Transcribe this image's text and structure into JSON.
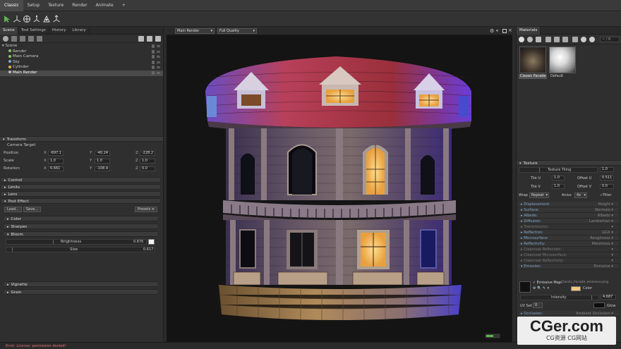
{
  "menubar": {
    "items": [
      "Classic",
      "Setup",
      "Texture",
      "Render",
      "Animate",
      "+"
    ],
    "active": "Classic"
  },
  "left_panel": {
    "tabs": [
      "Scene",
      "Tool Settings",
      "History",
      "Library"
    ],
    "active_tab": "Scene",
    "tree": [
      {
        "label": "Scene",
        "selected": false
      },
      {
        "label": "Render",
        "selected": false
      },
      {
        "label": "Main Camera",
        "selected": false
      },
      {
        "label": "Sky",
        "selected": false
      },
      {
        "label": "Cylinder",
        "selected": false
      },
      {
        "label": "Main Render",
        "selected": true
      }
    ],
    "transform": {
      "header": "Transform",
      "target": "Camera Target",
      "rows": [
        {
          "label": "Position",
          "x": "-697.1",
          "y": "-40.24",
          "z": "-228.2"
        },
        {
          "label": "Scale",
          "x": "1.0",
          "y": "1.0",
          "z": "1.0"
        },
        {
          "label": "Rotation",
          "x": "6.661",
          "y": "-108.9",
          "z": "0.0"
        }
      ],
      "axis_labels": {
        "x": "X",
        "y": "Y",
        "z": "Z"
      }
    },
    "sections": [
      "Control",
      "Limits",
      "Lens",
      "Post Effect"
    ],
    "post_effect": {
      "load": "Load...",
      "save": "Save...",
      "presets": "Presets",
      "subsections": [
        "Color",
        "Sharpen",
        "Bloom",
        "Vignette",
        "Grain"
      ],
      "bloom": {
        "brightness_label": "Brightness",
        "brightness_value": "0.876",
        "size_label": "Size",
        "size_value": "0.617"
      }
    }
  },
  "viewport": {
    "dropdown_render": "Main Render",
    "dropdown_quality": "Full Quality"
  },
  "right_panel": {
    "tab": "Materials",
    "filter_text": "~ / 6",
    "materials": [
      {
        "name": "Classic Facade",
        "selected": true
      },
      {
        "name": "Default",
        "selected": false
      }
    ],
    "texture": {
      "header": "Texture",
      "tiling_label": "Texture Tiling",
      "tiling_value": "1.0",
      "tile_u_label": "Tile U",
      "tile_u": "1.0",
      "offset_u_label": "Offset U",
      "offset_u": "0.511",
      "tile_v_label": "Tile V",
      "tile_v": "1.0",
      "offset_v_label": "Offset V",
      "offset_v": "0.0",
      "wrap_label": "Wrap",
      "wrap_value": "Repeat",
      "aniso_label": "Aniso",
      "aniso_value": "4x",
      "filter_label": "Filter"
    },
    "channels": [
      {
        "label": "Displacement:",
        "value": "Height",
        "dim": false
      },
      {
        "label": "Surface:",
        "value": "Normals",
        "dim": false
      },
      {
        "label": "Albedo:",
        "value": "Albedo",
        "dim": false
      },
      {
        "label": "Diffusion:",
        "value": "Lambertian",
        "dim": false
      },
      {
        "label": "Transmission:",
        "value": "",
        "dim": true
      },
      {
        "label": "Reflection:",
        "value": "GGX",
        "dim": false
      },
      {
        "label": "Microsurface:",
        "value": "Roughness",
        "dim": false
      },
      {
        "label": "Reflectivity:",
        "value": "Metalness",
        "dim": false
      },
      {
        "label": "Clearcoat Reflection:",
        "value": "",
        "dim": true
      },
      {
        "label": "Clearcoat Microsurface:",
        "value": "",
        "dim": true
      },
      {
        "label": "Clearcoat Reflectivity:",
        "value": "",
        "dim": true
      },
      {
        "label": "Emission:",
        "value": "Emissive",
        "dim": false
      }
    ],
    "emission": {
      "map_label": "Emissive Map:",
      "map_file": "Classic_Facade_emissive.png",
      "color_label": "Color",
      "color_swatch": "#f2c77e",
      "intensity_label": "Intensity",
      "intensity_value": "4.687",
      "uv_set_label": "UV Set",
      "uv_set_value": "0",
      "glow_label": "Glow"
    },
    "occlusion": {
      "label": "Occlusion:",
      "value": "Ambient Occlusion"
    }
  },
  "status": {
    "text": "Error: License: permission denied!"
  },
  "watermark": {
    "main": "CGer.com",
    "sub": "CG资源 CG网站"
  },
  "colors": {
    "accent_green": "#59b84a",
    "channel_blue": "#7fa6c9",
    "window_glow": "#f0c060"
  }
}
